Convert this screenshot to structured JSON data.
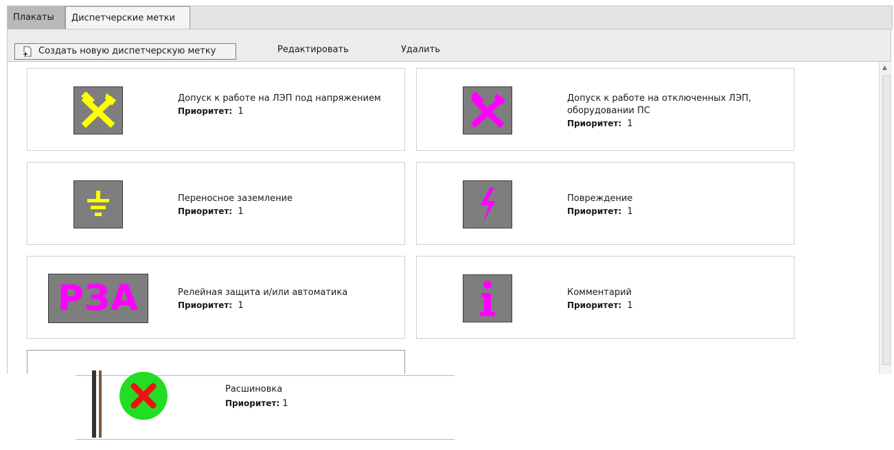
{
  "tabs": [
    {
      "label": "Плакаты"
    },
    {
      "label": "Диспетчерские метки"
    }
  ],
  "toolbar": {
    "create_label": "Создать новую диспетчерскую метку",
    "edit_label": "Редактировать",
    "delete_label": "Удалить"
  },
  "priority_label": "Приоритет:",
  "cards": [
    {
      "title": "Допуск к работе на ЛЭП под напряжением",
      "priority": "1",
      "icon": "crossed-tools-icon",
      "color": "#ffff00"
    },
    {
      "title": "Допуск к работе на отключенных ЛЭП, оборудовании ПС",
      "priority": "1",
      "icon": "crossed-tools-icon",
      "color": "#ff00ff"
    },
    {
      "title": "Переносное заземление",
      "priority": "1",
      "icon": "ground-icon",
      "color": "#ffff00"
    },
    {
      "title": "Повреждение",
      "priority": "1",
      "icon": "lightning-icon",
      "color": "#ff00ff"
    },
    {
      "title": "Релейная защита и/или автоматика",
      "priority": "1",
      "icon_text": "РЗА",
      "color": "#ff00ff"
    },
    {
      "title": "Комментарий",
      "priority": "1",
      "icon": "info-icon",
      "color": "#ff00ff"
    }
  ],
  "dragging": {
    "title": "Расшиновка",
    "priority": "1",
    "icon": "red-x-green-circle-icon"
  }
}
